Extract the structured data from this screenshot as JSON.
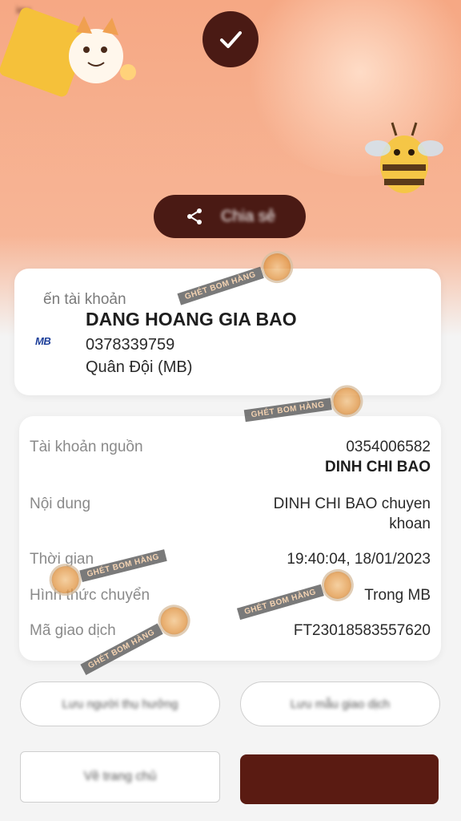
{
  "status_bar": {
    "left": "ieu",
    "right": ""
  },
  "share_button": {
    "label": "Chia sẻ"
  },
  "recipient": {
    "heading": "ến tài khoản",
    "bank_logo": "MB",
    "name": "DANG HOANG GIA BAO",
    "account": "0378339759",
    "bank": "Quân Đội (MB)"
  },
  "details": {
    "source_account": {
      "label": "Tài khoản nguồn",
      "value": "0354006582",
      "owner": "DINH CHI BAO"
    },
    "content": {
      "label": "Nội dung",
      "value_line1": "DINH CHI BAO chuyen",
      "value_line2": "khoan"
    },
    "time": {
      "label": "Thời gian",
      "value": "19:40:04, 18/01/2023"
    },
    "method": {
      "label": "Hình thức chuyển",
      "value": "Trong MB"
    },
    "transaction_id": {
      "label": "Mã giao dịch",
      "value": "FT23018583557620"
    }
  },
  "actions": {
    "save_recipient": "Lưu người thụ hưởng",
    "save_template": "Lưu mẫu giao dịch",
    "home": "Về trang chủ"
  },
  "watermark": {
    "text": "GHÉT BOM HÀNG"
  },
  "colors": {
    "accent_dark": "#4a1a14",
    "hero_orange": "#f6a884",
    "watermark_badge": "#e39a4b"
  },
  "icons": [
    "check-icon",
    "share-icon",
    "bank-logo-mb",
    "watermark-badge"
  ]
}
